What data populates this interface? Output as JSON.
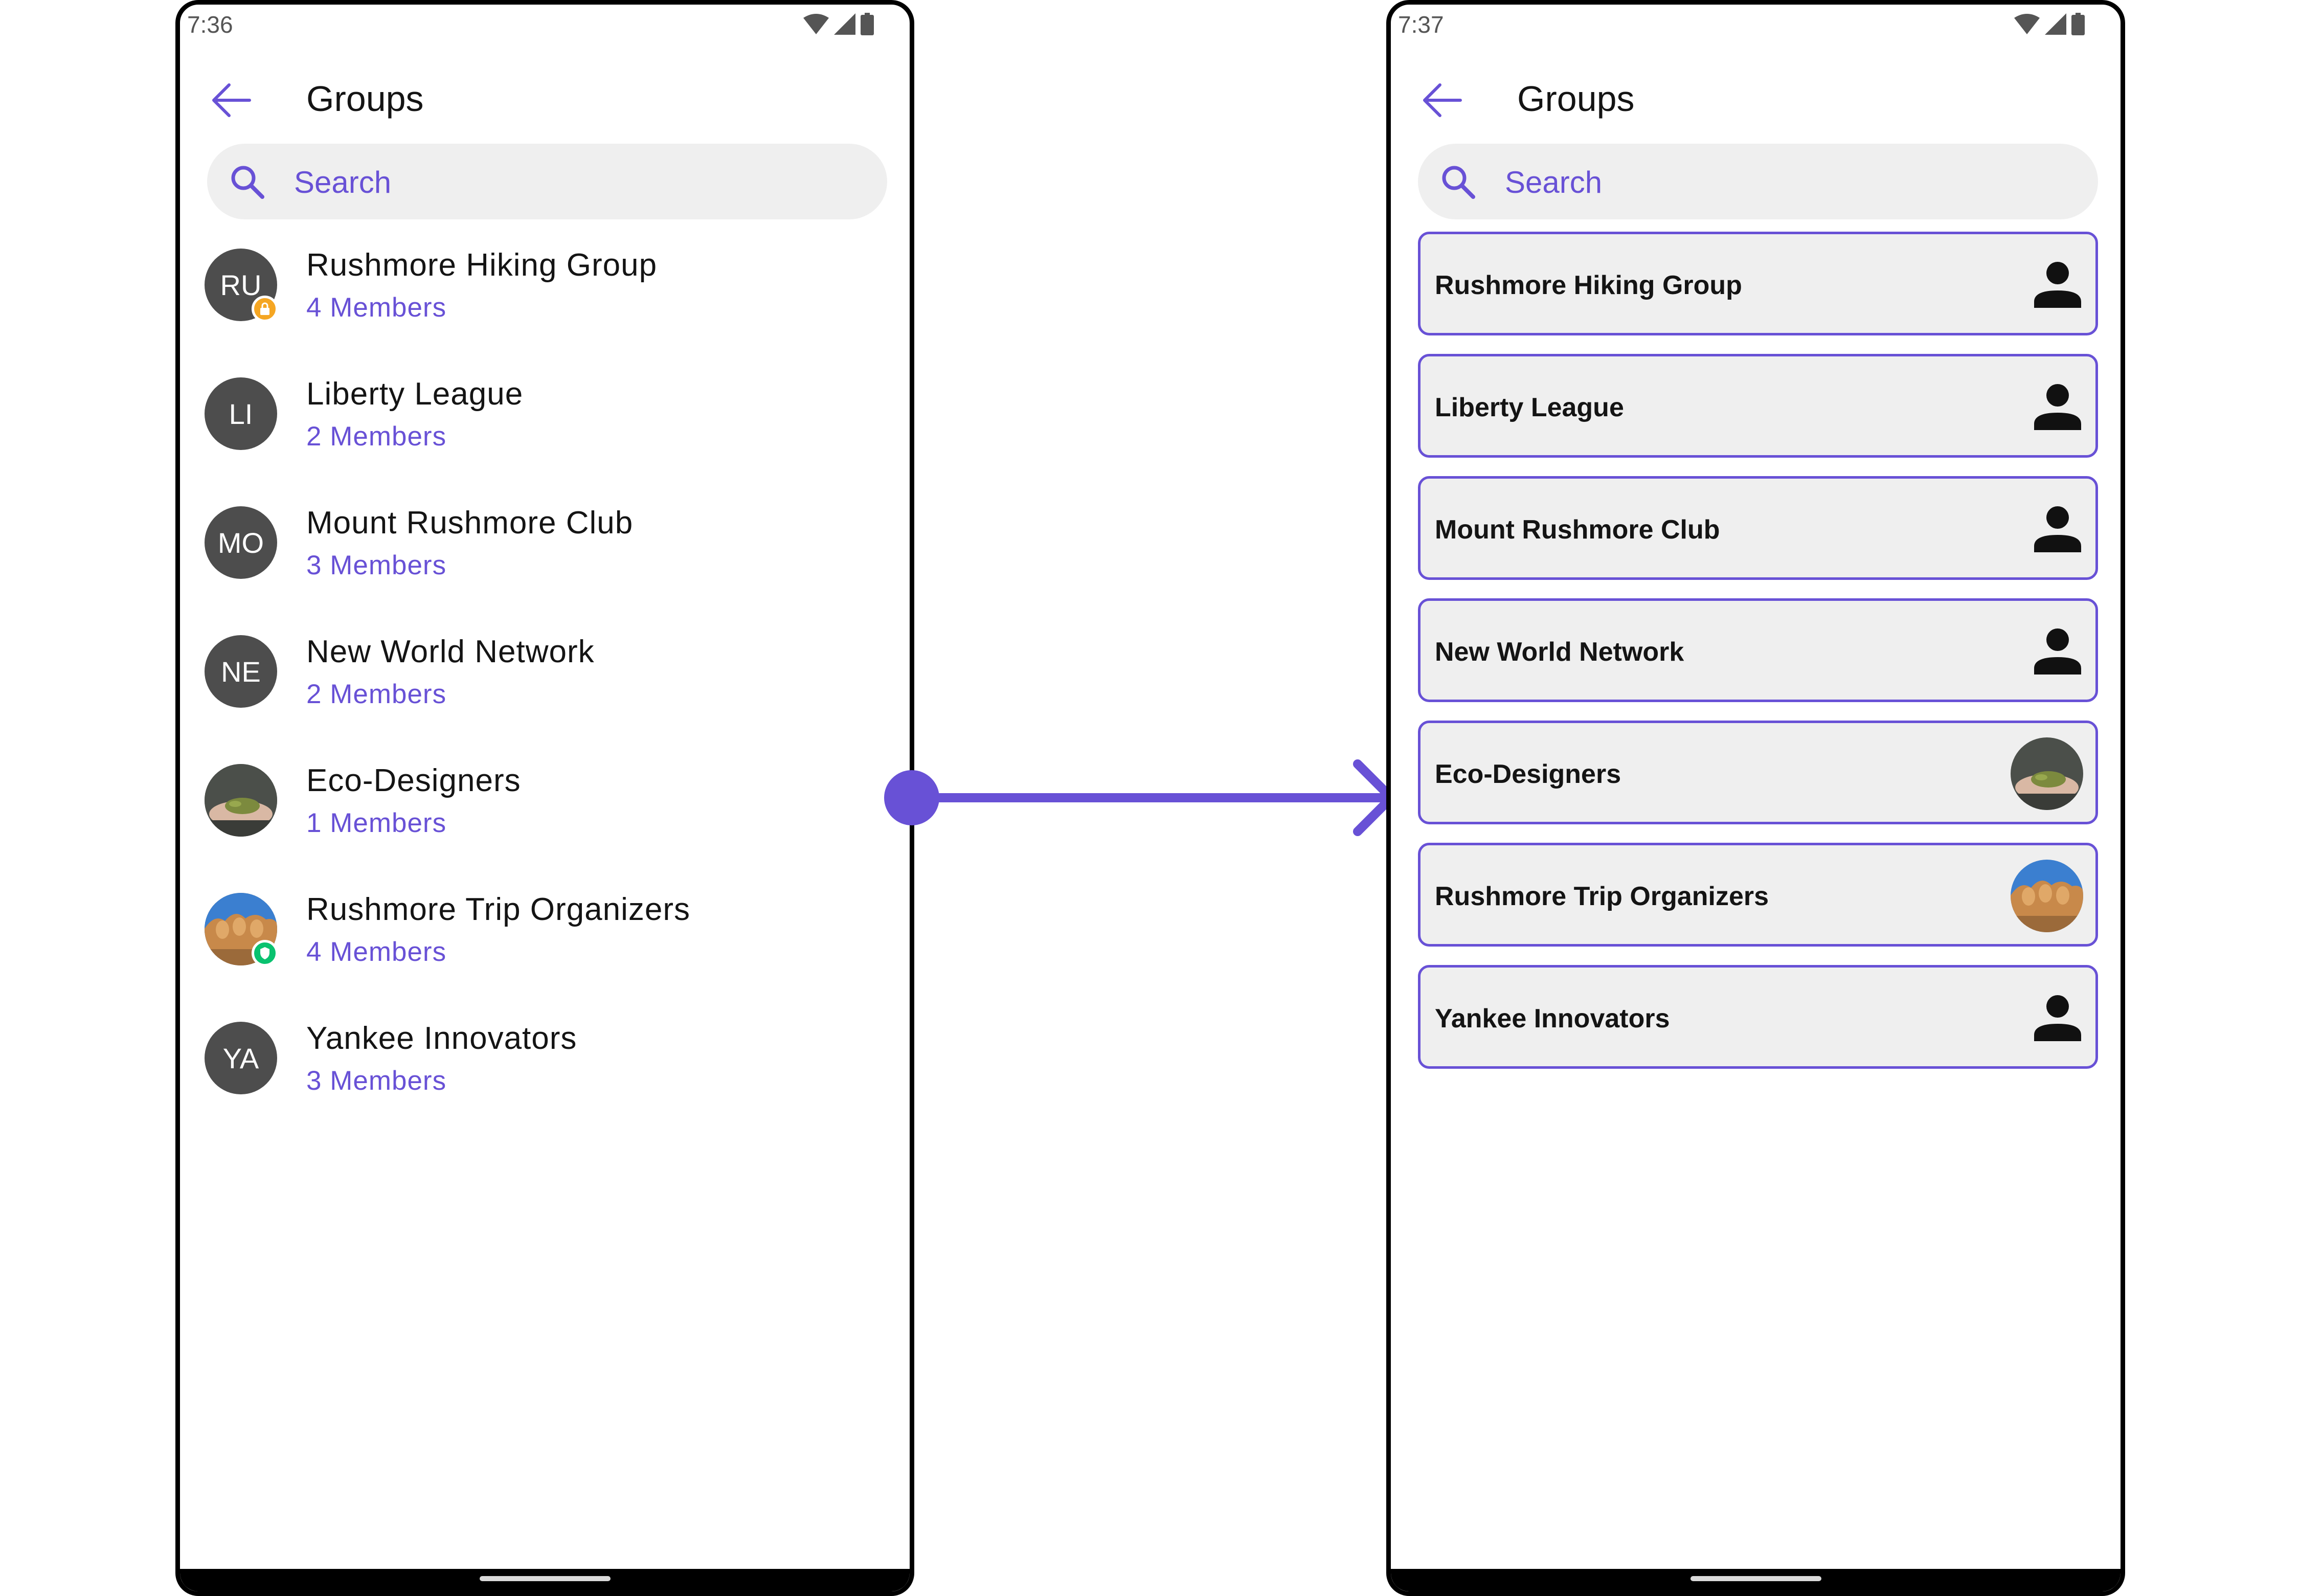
{
  "screens": {
    "before": {
      "status": {
        "time": "7:36"
      },
      "title": "Groups",
      "search": {
        "placeholder": "Search"
      },
      "groups": [
        {
          "initials": "RU",
          "name": "Rushmore Hiking Group",
          "members": "4 Members",
          "badge": "lock-badge"
        },
        {
          "initials": "LI",
          "name": "Liberty League",
          "members": "2 Members"
        },
        {
          "initials": "MO",
          "name": "Mount Rushmore Club",
          "members": "3 Members"
        },
        {
          "initials": "NE",
          "name": "New World Network",
          "members": "2 Members"
        },
        {
          "name": "Eco-Designers",
          "members": "1 Members",
          "avatar": "hands-soil-photo"
        },
        {
          "name": "Rushmore Trip Organizers",
          "members": "4 Members",
          "avatar": "mount-rushmore-photo",
          "badge": "shield-badge"
        },
        {
          "initials": "YA",
          "name": "Yankee Innovators",
          "members": "3 Members"
        }
      ]
    },
    "after": {
      "status": {
        "time": "7:37"
      },
      "title": "Groups",
      "search": {
        "placeholder": "Search"
      },
      "groups": [
        {
          "name": "Rushmore Hiking Group",
          "icon": "person-icon"
        },
        {
          "name": "Liberty League",
          "icon": "person-icon"
        },
        {
          "name": "Mount Rushmore Club",
          "icon": "person-icon"
        },
        {
          "name": "New World Network",
          "icon": "person-icon"
        },
        {
          "name": "Eco-Designers",
          "avatar": "hands-soil-photo"
        },
        {
          "name": "Rushmore Trip Organizers",
          "avatar": "mount-rushmore-photo"
        },
        {
          "name": "Yankee Innovators",
          "icon": "person-icon"
        }
      ]
    }
  },
  "colors": {
    "accent": "#6851d6",
    "avatar_bg": "#4d4d4d",
    "card_bg": "#efefef",
    "lock_badge": "#f5a623",
    "shield_badge": "#09c26f"
  }
}
